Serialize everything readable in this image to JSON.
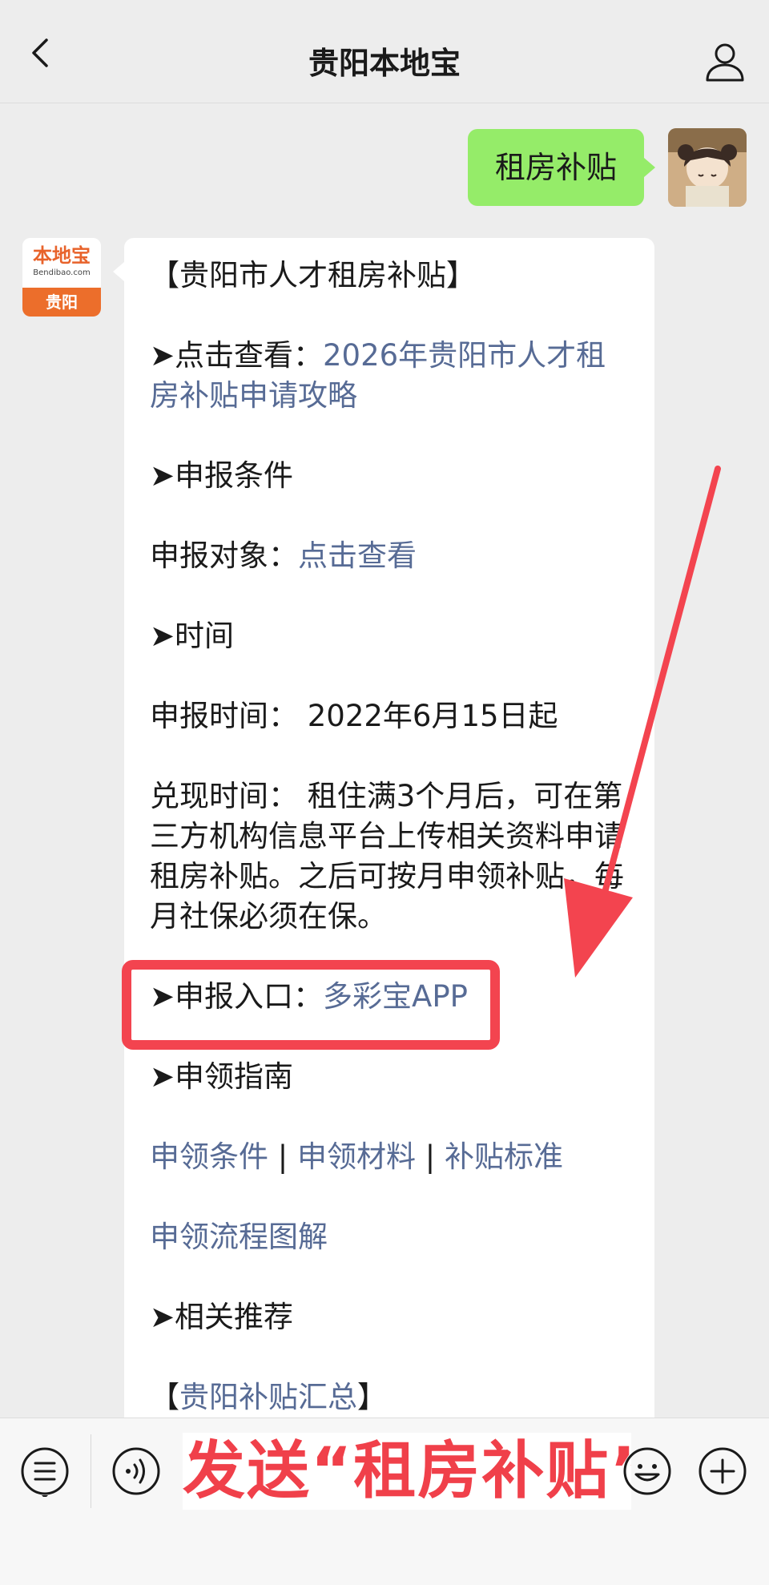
{
  "header": {
    "title": "贵阳本地宝"
  },
  "sent": {
    "text": "租房补贴"
  },
  "logo": {
    "mark": "本地宝",
    "url": "Bendibao.com",
    "city": "贵阳"
  },
  "message": {
    "title": "【贵阳市人才租房补贴】",
    "view_prefix": "➤点击查看：",
    "view_link": "2026年贵阳市人才租房补贴申请攻略",
    "conditions_head": "➤申报条件",
    "target_prefix": "申报对象：",
    "target_link": "点击查看",
    "time_head": "➤时间",
    "apply_time": "申报时间：  2022年6月15日起",
    "cash_time": "兑现时间：  租住满3个月后，可在第三方机构信息平台上传相关资料申请租房补贴。之后可按月申领补贴，每月社保必须在保。",
    "entry_prefix": "➤申报入口：",
    "entry_link": "多彩宝APP",
    "guide_head": "➤申领指南",
    "guide_links": [
      "申领条件",
      "申领材料",
      "补贴标准"
    ],
    "separator": " | ",
    "flow_link": "申领流程图解",
    "related_head": "➤相关推荐",
    "summary_open": "【",
    "summary_link": "贵阳补贴汇总",
    "summary_close": "】"
  },
  "overlay": {
    "text": "发送“租房补贴”"
  },
  "colors": {
    "link": "#576b95",
    "highlight": "#f3444f",
    "sent_bubble": "#95ec69"
  },
  "icons": [
    "back-icon",
    "profile-icon",
    "menu-icon",
    "voice-icon",
    "emoji-icon",
    "plus-icon"
  ]
}
